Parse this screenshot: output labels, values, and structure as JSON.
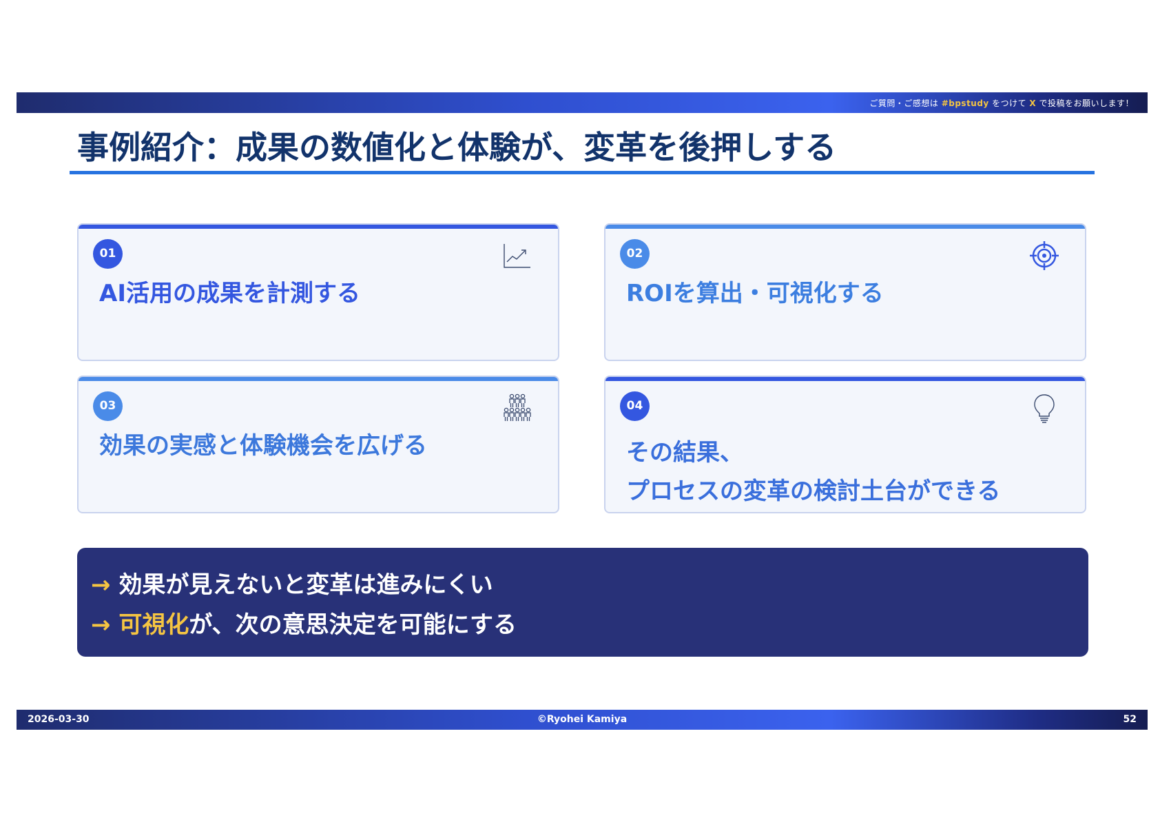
{
  "header": {
    "message_prefix": "ご質問・ご感想は ",
    "hashtag": "#bpstudy",
    "message_mid": " をつけて ",
    "platform": "X",
    "message_suffix": " で投稿をお願いします！"
  },
  "title": "事例紹介：成果の数値化と体験が、変革を後押しする",
  "cards": [
    {
      "number": "01",
      "text": "AI活用の成果を計測する",
      "icon": "chart-line-icon"
    },
    {
      "number": "02",
      "text": "ROIを算出・可視化する",
      "icon": "target-icon"
    },
    {
      "number": "03",
      "text": "効果の実感と体験機会を広げる",
      "icon": "people-group-icon"
    },
    {
      "number": "04",
      "text_line1": "その結果、",
      "text_line2": "プロセスの変革の検討土台ができる",
      "icon": "lightbulb-icon"
    }
  ],
  "summary": {
    "arrow": "→",
    "line1": "効果が見えないと変革は進みにくい",
    "line2_highlight": "可視化",
    "line2_rest": "が、次の意思決定を可能にする"
  },
  "footer": {
    "date": "2026-03-30",
    "copyright": "©Ryohei Kamiya",
    "page": "52"
  },
  "colors": {
    "title": "#12336b",
    "accent_blue": "#3457e0",
    "accent_light_blue": "#4a8be8",
    "summary_bg": "#283178",
    "highlight_yellow": "#f5c542"
  }
}
